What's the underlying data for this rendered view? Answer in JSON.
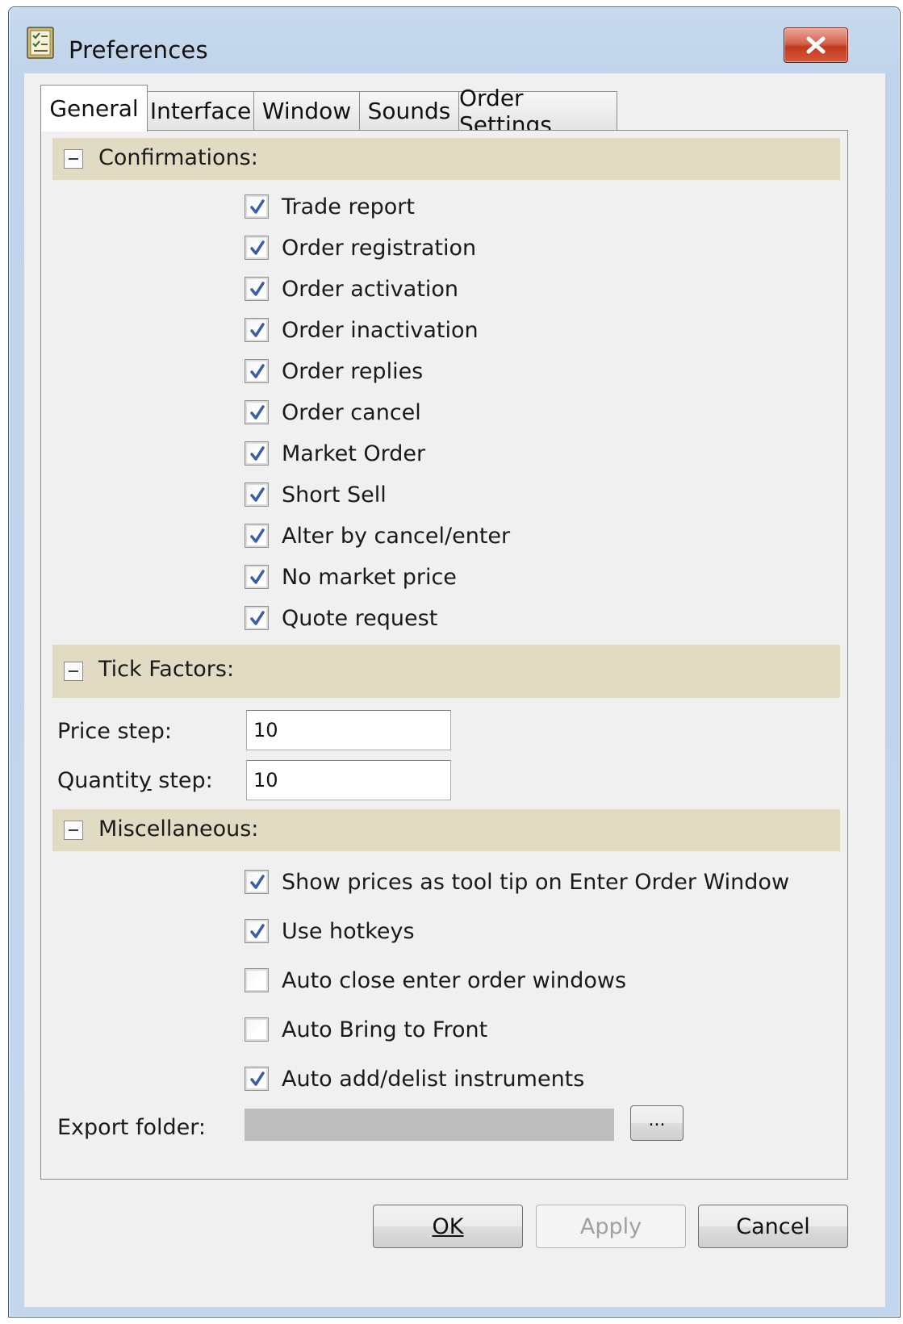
{
  "window": {
    "title": "Preferences"
  },
  "tabs": [
    {
      "label": "General",
      "active": true
    },
    {
      "label": "Interface",
      "active": false
    },
    {
      "label": "Window",
      "active": false
    },
    {
      "label": "Sounds",
      "active": false
    },
    {
      "label": "Order Settings",
      "active": false
    }
  ],
  "confirmations": {
    "title": "Confirmations:",
    "items": [
      {
        "label": "Trade report",
        "checked": true
      },
      {
        "label": "Order registration",
        "checked": true
      },
      {
        "label": "Order activation",
        "checked": true
      },
      {
        "label": "Order inactivation",
        "checked": true
      },
      {
        "label": "Order replies",
        "checked": true
      },
      {
        "label": "Order cancel",
        "checked": true
      },
      {
        "label": "Market Order",
        "checked": true
      },
      {
        "label": "Short Sell",
        "checked": true
      },
      {
        "label": "Alter by cancel/enter",
        "checked": true
      },
      {
        "label": "No market price",
        "checked": true
      },
      {
        "label": "Quote request",
        "checked": true
      }
    ]
  },
  "tick_factors": {
    "title": "Tick Factors:",
    "price_step_label": "Price step:",
    "price_step_value": "10",
    "quantity_step_label": "Quantity step:",
    "quantity_step_value": "10"
  },
  "miscellaneous": {
    "title": "Miscellaneous:",
    "items": [
      {
        "label": "Show prices as tool tip on Enter Order Window",
        "checked": true
      },
      {
        "label": "Use hotkeys",
        "checked": true
      },
      {
        "label": "Auto close enter order windows",
        "checked": false
      },
      {
        "label": "Auto Bring to Front",
        "checked": false
      },
      {
        "label": "Auto add/delist instruments",
        "checked": true
      }
    ],
    "export_folder_label": "Export folder:",
    "export_folder_value": "",
    "browse_label": "..."
  },
  "buttons": {
    "ok": "OK",
    "apply": "Apply",
    "cancel": "Cancel"
  },
  "colors": {
    "section_header": "#e1dbc4",
    "check_mark": "#3a5fa8",
    "close_button": "#c2391f"
  }
}
